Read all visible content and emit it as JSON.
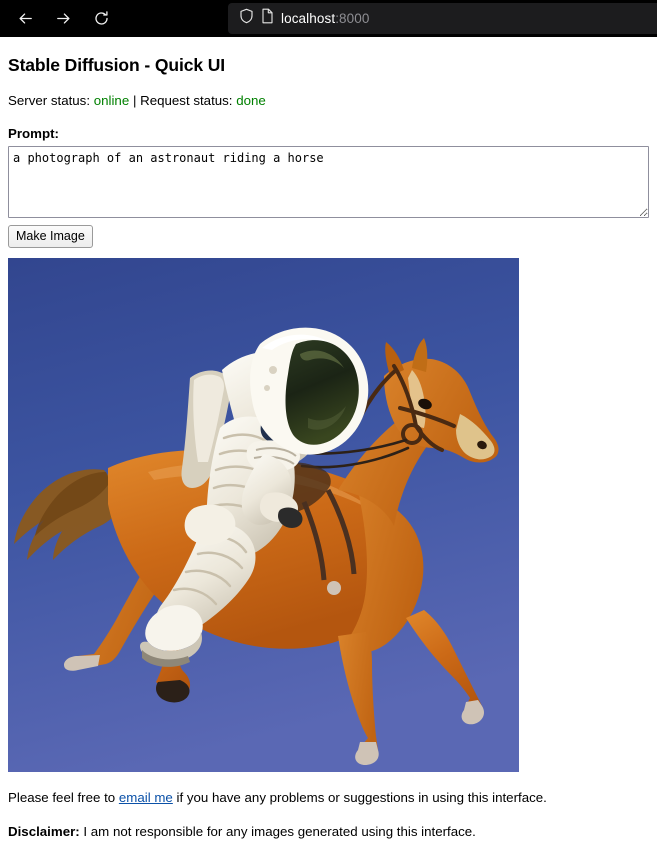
{
  "browser": {
    "back_icon": "back-arrow-icon",
    "forward_icon": "forward-arrow-icon",
    "reload_icon": "reload-icon",
    "shield_icon": "shield-icon",
    "page_icon": "page-document-icon",
    "url_host": "localhost",
    "url_port": ":8000"
  },
  "page": {
    "title": "Stable Diffusion - Quick UI",
    "status": {
      "server_label": "Server status:",
      "server_value": "online",
      "separator": "|",
      "request_label": "Request status:",
      "request_value": "done",
      "ok_color": "#008000"
    },
    "prompt": {
      "label": "Prompt:",
      "value": "a photograph of an astronaut riding a horse",
      "placeholder": ""
    },
    "submit_label": "Make Image",
    "result": {
      "alt": "a photograph of an astronaut riding a horse",
      "sky_color": "#3c54a0",
      "horse_color": "#d4731f",
      "suit_color": "#f2efe6",
      "visor_color": "#1d2a18",
      "width": "511",
      "height": "514"
    },
    "footer": {
      "line1_before": "Please feel free to ",
      "line1_link": "email me",
      "line1_after": " if you have any problems or suggestions in using this interface.",
      "line2_bold": "Disclaimer:",
      "line2_rest": " I am not responsible for any images generated using this interface."
    }
  }
}
